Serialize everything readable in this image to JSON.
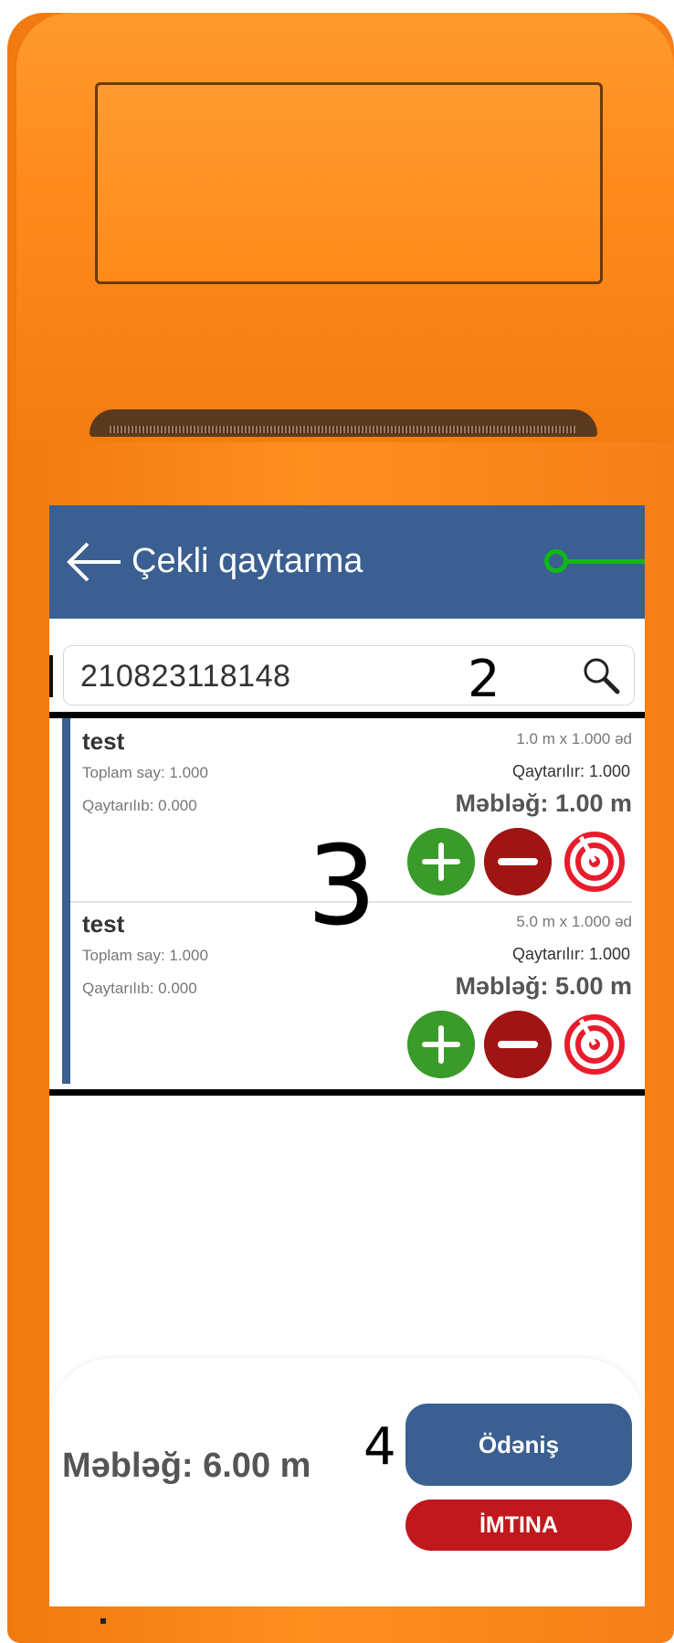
{
  "appbar": {
    "title": "Çekli qaytarma"
  },
  "search": {
    "value": "210823118148"
  },
  "markers": {
    "two": "2",
    "three": "3",
    "four": "4"
  },
  "items": [
    {
      "name": "test",
      "total": "Toplam say: 1.000",
      "returned": "Qaytarılıb: 0.000",
      "qty_price": "1.0 m x 1.000 əd",
      "to_return": "Qaytarılır: 1.000",
      "amount": "Məbləğ: 1.00 m"
    },
    {
      "name": "test",
      "total": "Toplam say: 1.000",
      "returned": "Qaytarılıb: 0.000",
      "qty_price": "5.0 m x 1.000 əd",
      "to_return": "Qaytarılır: 1.000",
      "amount": "Məbləğ: 5.00 m"
    }
  ],
  "footer": {
    "total": "Məbləğ: 6.00 m",
    "pay_label": "Ödəniş",
    "cancel_label": "İMTINA"
  },
  "colors": {
    "appbar": "#3a5f90",
    "plus": "#3a9a2a",
    "minus": "#a01414",
    "target": "#e81c2c",
    "cancel": "#c0181c",
    "device": "#ff8a1c",
    "callout": "#10b818"
  },
  "icons": [
    "back-arrow-icon",
    "search-icon",
    "plus-icon",
    "minus-icon",
    "target-icon"
  ]
}
